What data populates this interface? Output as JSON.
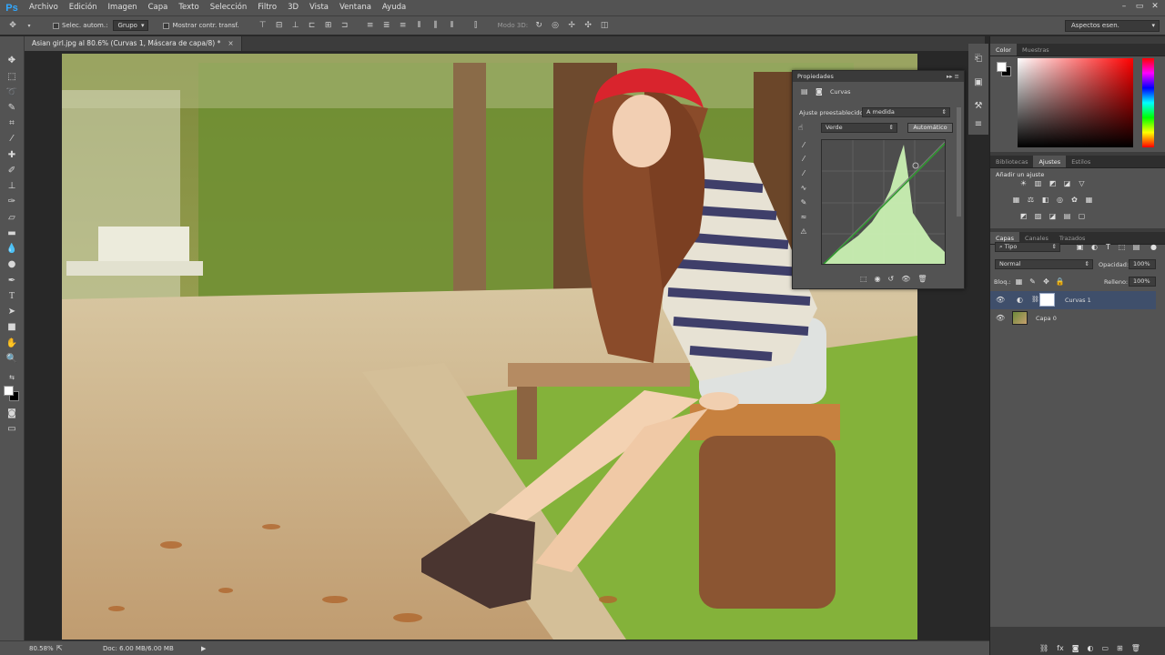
{
  "app": {
    "logo": "Ps"
  },
  "menu": [
    "Archivo",
    "Edición",
    "Imagen",
    "Capa",
    "Texto",
    "Selección",
    "Filtro",
    "3D",
    "Vista",
    "Ventana",
    "Ayuda"
  ],
  "window_controls": [
    "–",
    "▭",
    "✕"
  ],
  "options": {
    "auto_select": "Selec. autom.:",
    "group_value": "Grupo",
    "transform": "Mostrar contr. transf.",
    "mode3d": "Modo 3D:",
    "workspace": "Aspectos esen."
  },
  "document": {
    "tab": "Asian girl.jpg al 80.6% (Curvas 1, Máscara de capa/8) *",
    "close": "×"
  },
  "status": {
    "zoom": "80.58%",
    "doc": "Doc: 6.00 MB/6.00 MB"
  },
  "properties": {
    "title": "Propiedades",
    "heading": "Curvas",
    "preset_label": "Ajuste preestablecido:",
    "preset_value": "A medida",
    "channel": "Verde",
    "auto_button": "Automático"
  },
  "color_panel": {
    "tabs": [
      "Color",
      "Muestras"
    ]
  },
  "adjust_panel": {
    "tabs": [
      "Bibliotecas",
      "Ajustes",
      "Estilos"
    ],
    "heading": "Añadir un ajuste"
  },
  "layers_panel": {
    "tabs": [
      "Capas",
      "Canales",
      "Trazados"
    ],
    "filter": "Tipo",
    "blend": "Normal",
    "opacity_label": "Opacidad:",
    "opacity": "100%",
    "lock_label": "Bloq.:",
    "fill_label": "Relleno:",
    "fill": "100%",
    "layers": [
      {
        "name": "Curvas 1",
        "selected": true
      },
      {
        "name": "Capa 0",
        "selected": false
      }
    ]
  },
  "colors": {
    "accent": "#31a8ff",
    "panel": "#535353",
    "dark": "#282828"
  }
}
